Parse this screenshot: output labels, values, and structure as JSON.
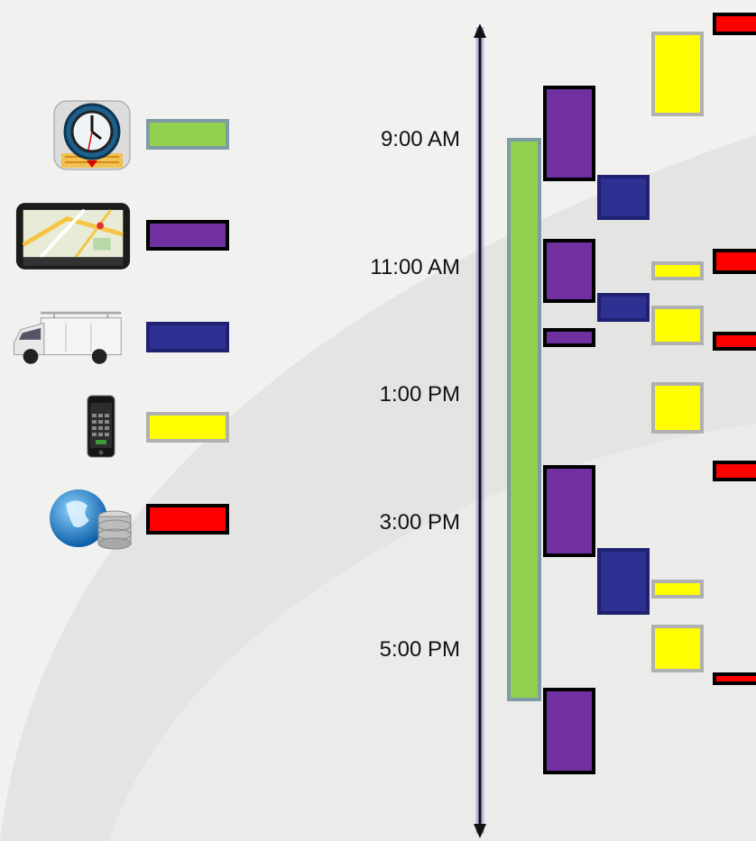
{
  "legend": [
    {
      "icon": "clock-app-icon",
      "color": "#92d050",
      "border": "#7f9ba6"
    },
    {
      "icon": "gps-navigator-icon",
      "color": "#7030a0",
      "border": "#000000"
    },
    {
      "icon": "service-van-icon",
      "color": "#2e3192",
      "border": "#1f2270"
    },
    {
      "icon": "smartphone-icon",
      "color": "#ffff00",
      "border": "#b0b0b0"
    },
    {
      "icon": "globe-database-icon",
      "color": "#ff0000",
      "border": "#000000"
    }
  ],
  "timeline": {
    "axis_color": "#111111",
    "axis_glow": "#8a8ad8",
    "start_hour": 7,
    "end_hour": 19,
    "labels": [
      {
        "text": "9:00 AM",
        "hour": 9
      },
      {
        "text": "11:00 AM",
        "hour": 11
      },
      {
        "text": "1:00 PM",
        "hour": 13
      },
      {
        "text": "3:00 PM",
        "hour": 15
      },
      {
        "text": "5:00 PM",
        "hour": 17
      }
    ],
    "events": [
      {
        "series": 0,
        "lane": 0,
        "start": 8.97,
        "end": 17.8
      },
      {
        "series": 1,
        "lane": 1,
        "start": 8.15,
        "end": 9.65
      },
      {
        "series": 1,
        "lane": 1,
        "start": 10.55,
        "end": 11.55
      },
      {
        "series": 1,
        "lane": 1,
        "start": 11.95,
        "end": 12.25
      },
      {
        "series": 1,
        "lane": 1,
        "start": 14.1,
        "end": 15.55
      },
      {
        "series": 1,
        "lane": 1,
        "start": 17.6,
        "end": 18.95
      },
      {
        "series": 2,
        "lane": 2,
        "start": 9.55,
        "end": 10.25
      },
      {
        "series": 2,
        "lane": 2,
        "start": 11.4,
        "end": 11.85
      },
      {
        "series": 2,
        "lane": 2,
        "start": 15.4,
        "end": 16.45
      },
      {
        "series": 3,
        "lane": 3,
        "start": 7.3,
        "end": 8.63
      },
      {
        "series": 3,
        "lane": 3,
        "start": 10.9,
        "end": 11.2
      },
      {
        "series": 3,
        "lane": 3,
        "start": 11.6,
        "end": 12.22
      },
      {
        "series": 3,
        "lane": 3,
        "start": 12.8,
        "end": 13.6
      },
      {
        "series": 3,
        "lane": 3,
        "start": 15.9,
        "end": 16.2
      },
      {
        "series": 3,
        "lane": 3,
        "start": 16.6,
        "end": 17.35
      },
      {
        "series": 4,
        "lane": 4,
        "start": 7.0,
        "end": 7.35
      },
      {
        "series": 4,
        "lane": 4,
        "start": 10.7,
        "end": 11.1
      },
      {
        "series": 4,
        "lane": 4,
        "start": 12.0,
        "end": 12.3
      },
      {
        "series": 4,
        "lane": 4,
        "start": 14.03,
        "end": 14.35
      },
      {
        "series": 4,
        "lane": 4,
        "start": 17.35,
        "end": 17.55
      }
    ]
  }
}
